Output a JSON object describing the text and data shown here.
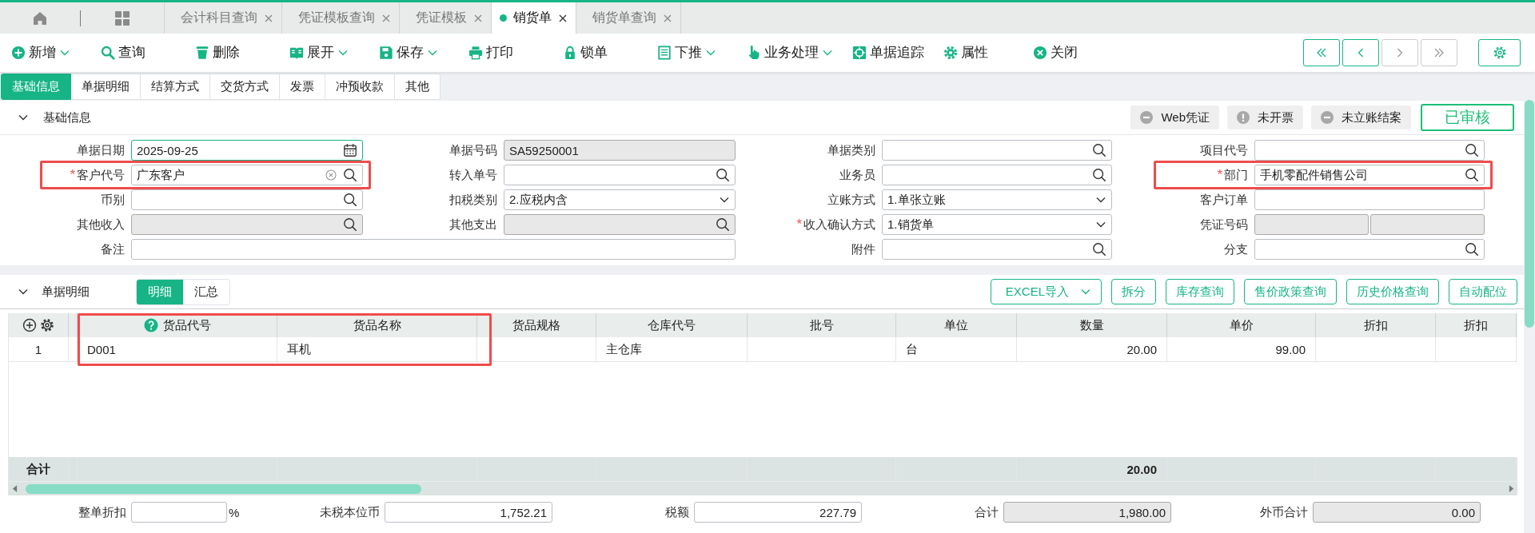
{
  "doc_tabs": [
    {
      "label": "会计科目查询",
      "selected": false
    },
    {
      "label": "凭证模板查询",
      "selected": false
    },
    {
      "label": "凭证模板",
      "selected": false
    },
    {
      "label": "销货单",
      "selected": true
    },
    {
      "label": "销货单查询",
      "selected": false
    }
  ],
  "toolbar": [
    {
      "label": "新增",
      "menu": true
    },
    {
      "label": "查询",
      "menu": false
    },
    {
      "label": "删除",
      "menu": false
    },
    {
      "label": "展开",
      "menu": true
    },
    {
      "label": "保存",
      "menu": true
    },
    {
      "label": "打印",
      "menu": false
    },
    {
      "label": "锁单",
      "menu": false
    },
    {
      "label": "下推",
      "menu": true
    },
    {
      "label": "业务处理",
      "menu": true
    },
    {
      "label": "单据追踪",
      "menu": false
    },
    {
      "label": "属性",
      "menu": false
    },
    {
      "label": "关闭",
      "menu": false
    }
  ],
  "nav": [
    {
      "disabled": false
    },
    {
      "disabled": false
    },
    {
      "disabled": true
    },
    {
      "disabled": true
    }
  ],
  "section_tabs": [
    {
      "label": "基础信息",
      "selected": true
    },
    {
      "label": "单据明细",
      "selected": false
    },
    {
      "label": "结算方式",
      "selected": false
    },
    {
      "label": "交货方式",
      "selected": false
    },
    {
      "label": "发票",
      "selected": false
    },
    {
      "label": "冲预收款",
      "selected": false
    },
    {
      "label": "其他",
      "selected": false
    }
  ],
  "basic": {
    "title": "基础信息",
    "expanded": true,
    "badges": [
      {
        "label": "Web凭证",
        "kind": "minus"
      },
      {
        "label": "未开票",
        "kind": "alert"
      },
      {
        "label": "未立账结案",
        "kind": "minus"
      }
    ],
    "approval": "已审核",
    "fields": [
      {
        "label": "单据日期",
        "kind": "date",
        "value": "2025-09-25",
        "disabled": false,
        "focused": true,
        "highlighted": false
      },
      {
        "label": "单据号码",
        "kind": "text",
        "value": "SA59250001",
        "disabled": true,
        "focused": false,
        "highlighted": false
      },
      {
        "label": "单据类别",
        "kind": "lookup",
        "disabled": false,
        "focused": false,
        "highlighted": false
      },
      {
        "label": "项目代号",
        "kind": "lookup",
        "disabled": false,
        "focused": false,
        "highlighted": false
      },
      {
        "label": "客户代号",
        "required_mark": "*",
        "kind": "lookup",
        "clearable": true,
        "value": "广东客户",
        "disabled": false,
        "focused": false,
        "highlighted": true
      },
      {
        "label": "转入单号",
        "kind": "lookup",
        "disabled": false,
        "focused": false,
        "highlighted": false
      },
      {
        "label": "业务员",
        "kind": "lookup",
        "disabled": false,
        "focused": false,
        "highlighted": false
      },
      {
        "label": "部门",
        "required_mark": "*",
        "kind": "lookup",
        "value": "手机零配件销售公司",
        "disabled": false,
        "focused": false,
        "highlighted": true
      },
      {
        "label": "币别",
        "kind": "lookup",
        "disabled": false,
        "focused": false,
        "highlighted": false
      },
      {
        "label": "扣税类别",
        "kind": "select",
        "value": "2.应税内含",
        "disabled": false,
        "focused": false,
        "highlighted": false
      },
      {
        "label": "立账方式",
        "kind": "select",
        "value": "1.单张立账",
        "disabled": false,
        "focused": false,
        "highlighted": false
      },
      {
        "label": "客户订单",
        "kind": "text",
        "disabled": false,
        "focused": false,
        "highlighted": false
      },
      {
        "label": "其他收入",
        "kind": "lookup",
        "disabled": true,
        "focused": false,
        "highlighted": false
      },
      {
        "label": "其他支出",
        "kind": "lookup",
        "disabled": true,
        "focused": false,
        "highlighted": false
      },
      {
        "label": "收入确认方式",
        "required_mark": "*",
        "kind": "select",
        "value": "1.销货单",
        "disabled": false,
        "focused": false,
        "highlighted": false
      },
      {
        "label": "凭证号码",
        "kind": "split",
        "disabled": true,
        "focused": false,
        "highlighted": false
      },
      {
        "label": "备注",
        "kind": "wide",
        "disabled": false,
        "focused": false,
        "highlighted": false
      },
      {
        "label": "附件",
        "kind": "lookup",
        "disabled": false,
        "focused": false,
        "highlighted": false
      },
      {
        "label": "分支",
        "kind": "lookup",
        "disabled": false,
        "focused": false,
        "highlighted": false
      }
    ]
  },
  "detail": {
    "title": "单据明细",
    "expanded": true,
    "views": [
      {
        "label": "明细",
        "selected": true
      },
      {
        "label": "汇总",
        "selected": false
      }
    ],
    "actions": [
      {
        "label": "EXCEL导入",
        "menu": true
      },
      {
        "label": "拆分",
        "menu": false
      },
      {
        "label": "库存查询",
        "menu": false
      },
      {
        "label": "售价政策查询",
        "menu": false
      },
      {
        "label": "历史价格查询",
        "menu": false
      },
      {
        "label": "自动配位",
        "menu": false
      }
    ],
    "table": {
      "columns": [
        {
          "label": "货品代号",
          "kind": "text",
          "help": true,
          "highlighted": true
        },
        {
          "label": "货品名称",
          "kind": "text",
          "help": false,
          "highlighted": true
        },
        {
          "label": "货品规格",
          "kind": "text",
          "help": false,
          "highlighted": false
        },
        {
          "label": "仓库代号",
          "kind": "text",
          "help": false,
          "highlighted": false
        },
        {
          "label": "批号",
          "kind": "text",
          "help": false,
          "highlighted": false
        },
        {
          "label": "单位",
          "kind": "text",
          "help": false,
          "highlighted": false
        },
        {
          "label": "数量",
          "kind": "number",
          "help": false,
          "highlighted": false
        },
        {
          "label": "单价",
          "kind": "number",
          "help": false,
          "highlighted": false
        },
        {
          "label": "折扣",
          "kind": "number",
          "help": false,
          "highlighted": false
        },
        {
          "label": "折扣",
          "kind": "number",
          "help": false,
          "highlighted": false
        }
      ],
      "rows": [
        {
          "number": "1",
          "cells": [
            "D001",
            "耳机",
            null,
            "主仓库",
            null,
            "台",
            "20.00",
            "99.00",
            null,
            null
          ]
        }
      ],
      "total": {
        "label": "合计",
        "cells": [
          null,
          null,
          null,
          null,
          null,
          null,
          "20.00",
          null,
          null,
          null
        ]
      }
    },
    "summary": [
      {
        "label": "整单折扣",
        "suffix": "%",
        "disabled": false
      },
      {
        "label": "未税本位币",
        "value": "1,752.21",
        "disabled": false
      },
      {
        "label": "税额",
        "value": "227.79",
        "disabled": false
      },
      {
        "label": "合计",
        "value": "1,980.00",
        "disabled": true
      },
      {
        "label": "外币合计",
        "value": "0.00",
        "disabled": true
      }
    ]
  }
}
